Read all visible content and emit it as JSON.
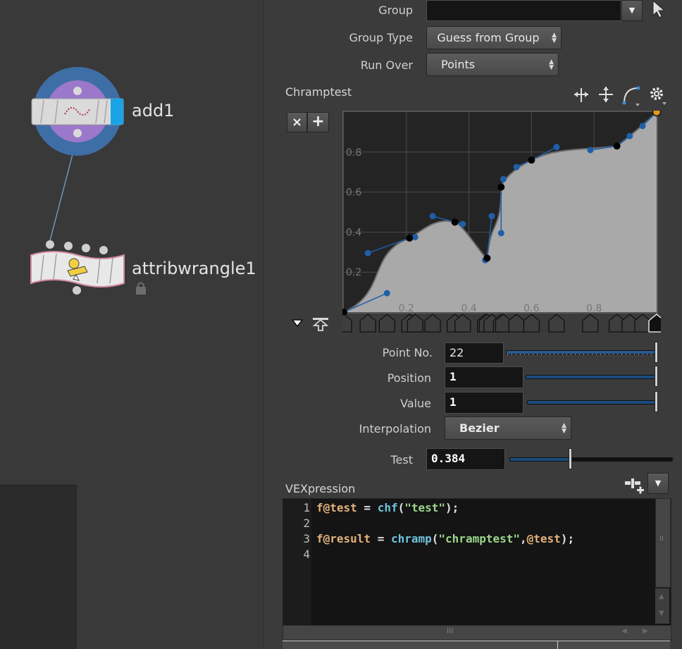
{
  "network": {
    "nodes": [
      {
        "name": "add1"
      },
      {
        "name": "attribwrangle1"
      }
    ]
  },
  "params": {
    "group_label": "Group",
    "group_value": "",
    "group_type_label": "Group Type",
    "group_type_value": "Guess from Group",
    "run_over_label": "Run Over",
    "run_over_value": "Points",
    "ramp_title": "Chramptest",
    "point_no_label": "Point No.",
    "point_no_value": "22",
    "position_label": "Position",
    "position_value": "1",
    "value_label": "Value",
    "value_value": "1",
    "interpolation_label": "Interpolation",
    "interpolation_value": "Bezier",
    "test_label": "Test",
    "test_value": "0.384",
    "vex_title": "VEXpression",
    "ramp_buttons": {
      "remove": "×",
      "add": "+"
    }
  },
  "ramp": {
    "x_ticks": [
      "0.2",
      "0.4",
      "0.6",
      "0.8"
    ],
    "y_ticks": [
      "0.2",
      "0.4",
      "0.6",
      "0.8"
    ],
    "curve_color": "#a9a9a9",
    "handle_color": "#1f5fa8",
    "key_points": [
      [
        0,
        0
      ],
      [
        0.21,
        0.37
      ],
      [
        0.355,
        0.45
      ],
      [
        0.458,
        0.27
      ],
      [
        0.503,
        0.625
      ],
      [
        0.6,
        0.76
      ],
      [
        0.873,
        0.83
      ],
      [
        1,
        1
      ]
    ],
    "handles": [
      [
        [
          0,
          0
        ],
        [
          0.138,
          0.095
        ]
      ],
      [
        [
          0.077,
          0.295
        ],
        [
          0.21,
          0.37
        ],
        [
          0.228,
          0.375
        ]
      ],
      [
        [
          0.284,
          0.48
        ],
        [
          0.355,
          0.45
        ],
        [
          0.38,
          0.44
        ]
      ],
      [
        [
          0.452,
          0.26
        ],
        [
          0.458,
          0.27
        ],
        [
          0.473,
          0.48
        ]
      ],
      [
        [
          0.503,
          0.395
        ],
        [
          0.503,
          0.625
        ],
        [
          0.51,
          0.665
        ]
      ],
      [
        [
          0.552,
          0.725
        ],
        [
          0.6,
          0.76
        ],
        [
          0.68,
          0.825
        ]
      ],
      [
        [
          0.788,
          0.81
        ],
        [
          0.873,
          0.83
        ],
        [
          0.914,
          0.88
        ]
      ],
      [
        [
          0.955,
          0.93
        ],
        [
          1,
          1
        ]
      ]
    ]
  },
  "code": {
    "line_numbers": [
      "1",
      "2",
      "3",
      "4"
    ],
    "l1_var": "f@test",
    "l1_eq": " = ",
    "l1_fn": "chf",
    "l1_open": "(",
    "l1_str": "\"test\"",
    "l1_close": ");",
    "l3_var": "f@result",
    "l3_eq": " = ",
    "l3_fn": "chramp",
    "l3_open": "(",
    "l3_str": "\"chramptest\"",
    "l3_comma": ",",
    "l3_arg": "@test",
    "l3_close": ");"
  }
}
